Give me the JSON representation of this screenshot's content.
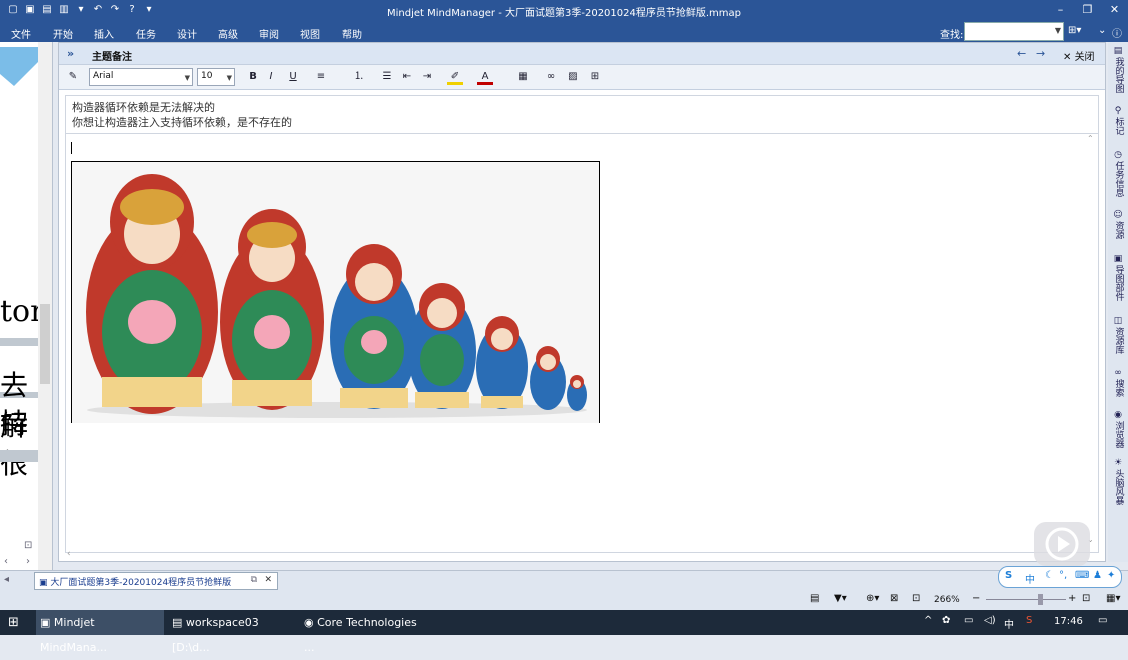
{
  "title": "Mindjet MindManager - 大厂面试题第3季-20201024程序员节抢鲜版.mmap",
  "menu": [
    "文件",
    "开始",
    "插入",
    "任务",
    "设计",
    "高级",
    "审阅",
    "视图",
    "帮助"
  ],
  "search_label": "查找:",
  "notes": {
    "header": "主题备注",
    "close": "关闭",
    "font": "Arial",
    "size": "10",
    "line1": "构造器循环依赖是无法解决的",
    "line2": "你想让构造器注入支持循环依赖，是不存在的"
  },
  "left_big": [
    "tor",
    "去解",
    "持很"
  ],
  "sidebar": [
    "我的导图",
    "标记",
    "任务信息",
    "资源",
    "导图部件",
    "资源库",
    "搜索",
    "浏览器",
    "头脑风暴"
  ],
  "doc_tab": "大厂面试题第3季-20201024程序员节抢鲜版",
  "zoom": "266%",
  "taskbar": {
    "apps": [
      "Mindjet MindMana...",
      "workspace03 [D:\\d...",
      "Core Technologies ..."
    ],
    "ime": "中",
    "time": "17:46"
  },
  "ime_bar": "中",
  "colors": {
    "title_bg": "#2b5597",
    "taskbar": "#1d2a3a"
  }
}
